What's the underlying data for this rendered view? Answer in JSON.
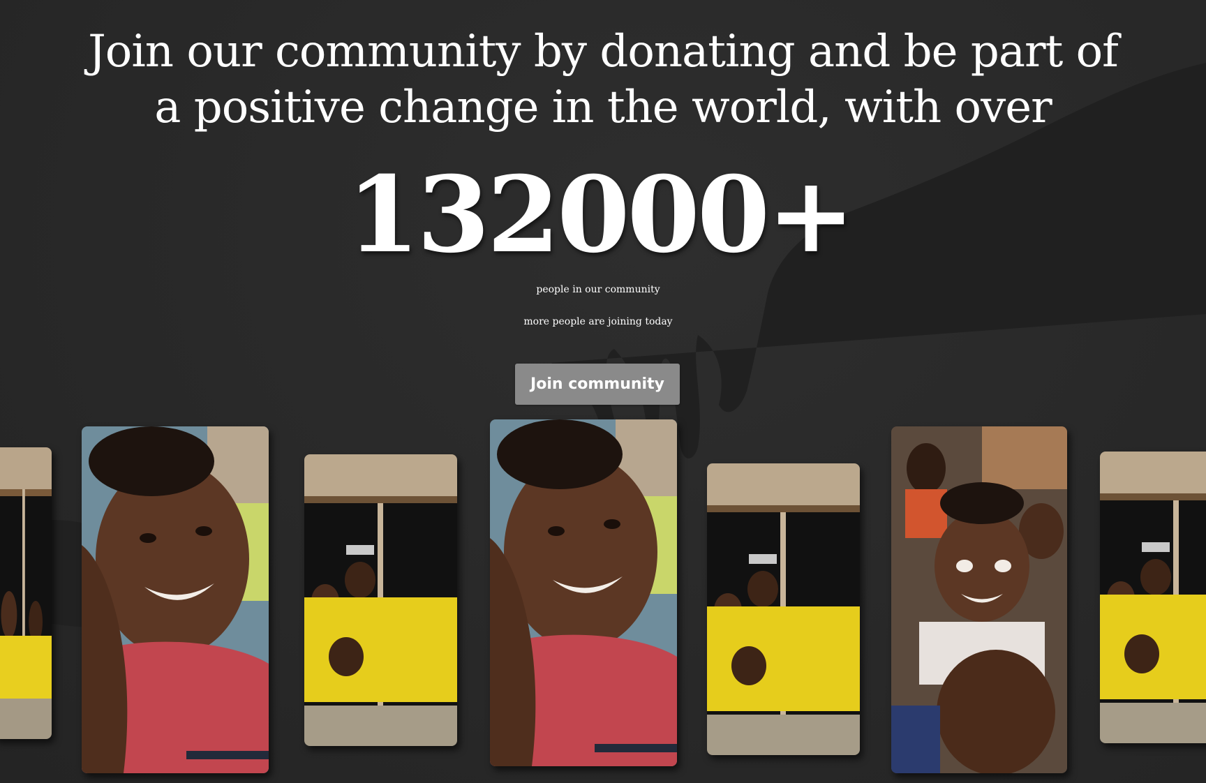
{
  "hero": {
    "headline_line1": "Join our community by donating and be part of",
    "headline_line2": "a positive change in the world, with over",
    "counter": "132000+",
    "counter_caption": "people in our community",
    "joining_caption": "more people are joining today",
    "join_button_label": "Join community"
  },
  "gallery": {
    "cards": [
      {
        "subject": "children-at-window",
        "partial": true
      },
      {
        "subject": "smiling-boy-red-shirt"
      },
      {
        "subject": "children-at-window"
      },
      {
        "subject": "smiling-boy-red-shirt"
      },
      {
        "subject": "children-at-window"
      },
      {
        "subject": "group-of-smiling-children"
      },
      {
        "subject": "children-at-window",
        "partial": true
      }
    ]
  },
  "colors": {
    "background": "#2a2a2a",
    "button": "#8a8a8a",
    "text": "#ffffff"
  }
}
